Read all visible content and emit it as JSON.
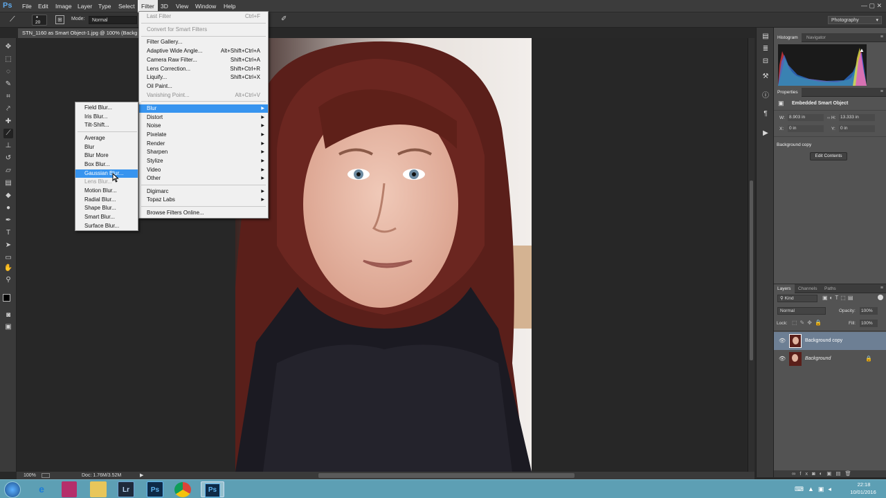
{
  "app": {
    "logo": "Ps"
  },
  "menubar": {
    "items": [
      "File",
      "Edit",
      "Image",
      "Layer",
      "Type",
      "Select",
      "Filter",
      "3D",
      "View",
      "Window",
      "Help"
    ],
    "active": "Filter"
  },
  "options": {
    "brush_size": "20",
    "mode_label": "Mode:",
    "mode_value": "Normal",
    "workspace": "Photography"
  },
  "document": {
    "tab_title": "STN_1160 as Smart Object-1.jpg @ 100% (Backg"
  },
  "filter_menu": {
    "items": [
      {
        "label": "Last Filter",
        "shortcut": "Ctrl+F",
        "disabled": true
      },
      {
        "label": "Convert for Smart Filters",
        "shortcut": "",
        "disabled": true
      },
      {
        "label": "Filter Gallery...",
        "shortcut": ""
      },
      {
        "label": "Adaptive Wide Angle...",
        "shortcut": "Alt+Shift+Ctrl+A"
      },
      {
        "label": "Camera Raw Filter...",
        "shortcut": "Shift+Ctrl+A"
      },
      {
        "label": "Lens Correction...",
        "shortcut": "Shift+Ctrl+R"
      },
      {
        "label": "Liquify...",
        "shortcut": "Shift+Ctrl+X"
      },
      {
        "label": "Oil Paint...",
        "shortcut": ""
      },
      {
        "label": "Vanishing Point...",
        "shortcut": "Alt+Ctrl+V",
        "disabled": true
      },
      {
        "label": "Blur",
        "submenu": true,
        "highlighted": true
      },
      {
        "label": "Distort",
        "submenu": true
      },
      {
        "label": "Noise",
        "submenu": true
      },
      {
        "label": "Pixelate",
        "submenu": true
      },
      {
        "label": "Render",
        "submenu": true
      },
      {
        "label": "Sharpen",
        "submenu": true
      },
      {
        "label": "Stylize",
        "submenu": true
      },
      {
        "label": "Video",
        "submenu": true
      },
      {
        "label": "Other",
        "submenu": true
      },
      {
        "label": "Digimarc",
        "submenu": true
      },
      {
        "label": "Topaz Labs",
        "submenu": true
      },
      {
        "label": "Browse Filters Online..."
      }
    ]
  },
  "blur_menu": {
    "items": [
      {
        "label": "Field Blur..."
      },
      {
        "label": "Iris Blur..."
      },
      {
        "label": "Tilt-Shift..."
      },
      {
        "label": "Average"
      },
      {
        "label": "Blur"
      },
      {
        "label": "Blur More"
      },
      {
        "label": "Box Blur..."
      },
      {
        "label": "Gaussian Blur...",
        "highlighted": true
      },
      {
        "label": "Lens Blur...",
        "disabled": true
      },
      {
        "label": "Motion Blur..."
      },
      {
        "label": "Radial Blur..."
      },
      {
        "label": "Shape Blur..."
      },
      {
        "label": "Smart Blur..."
      },
      {
        "label": "Surface Blur..."
      }
    ]
  },
  "histogram_panel": {
    "tabs": [
      "Histogram",
      "Navigator"
    ]
  },
  "properties_panel": {
    "tab": "Properties",
    "type": "Embedded Smart Object",
    "w_label": "W:",
    "w_value": "8.903 in",
    "h_label": "H:",
    "h_value": "13.333 in",
    "x_label": "X:",
    "x_value": "0 in",
    "y_label": "Y:",
    "y_value": "0 in",
    "layer_name": "Background copy",
    "edit_button": "Edit Contents"
  },
  "layers_panel": {
    "tabs": [
      "Layers",
      "Channels",
      "Paths"
    ],
    "filter_kind": "Kind",
    "blend_mode": "Normal",
    "opacity_label": "Opacity:",
    "opacity_value": "100%",
    "lock_label": "Lock:",
    "fill_label": "Fill:",
    "fill_value": "100%",
    "layers": [
      {
        "name": "Background copy",
        "selected": true
      },
      {
        "name": "Background",
        "locked": true
      }
    ]
  },
  "status_bar": {
    "zoom": "100%",
    "doc_info": "Doc: 1.76M/3.52M"
  },
  "taskbar": {
    "time": "22:18",
    "date": "10/01/2016",
    "apps": [
      "Lr",
      "Ps",
      "Ps"
    ]
  },
  "colors": {
    "menu_highlight": "#3794ef",
    "photoshop_blue": "#5fa8e8",
    "layer_selected": "#6d7f94"
  }
}
